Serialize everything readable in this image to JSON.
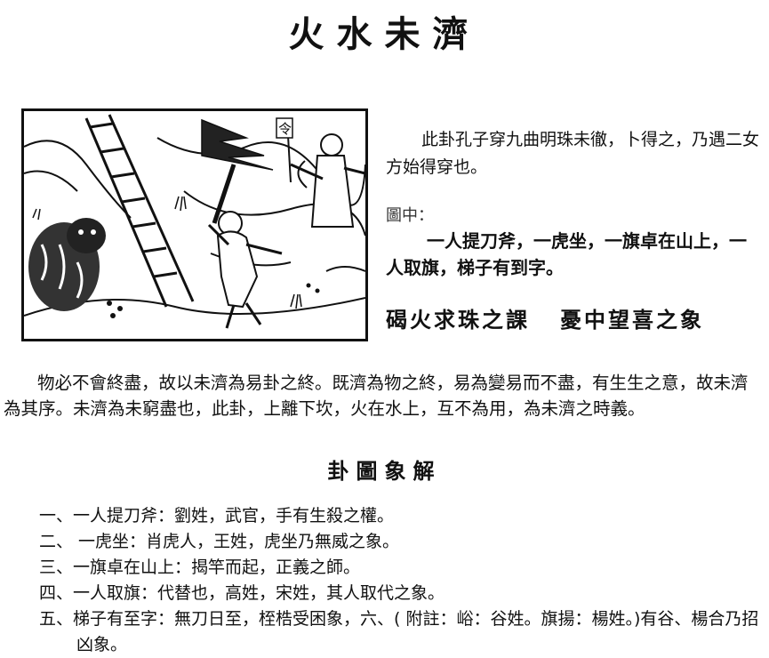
{
  "title": "火水未濟",
  "description": "此卦孔子穿九曲明珠未徹，卜得之，乃遇二女方始得穿也。",
  "figure_label": "圖中：",
  "figure_description": "一人提刀斧，一虎坐，一旗卓在山上，一人取旗，梯子有到字。",
  "lesson": {
    "name": "碣火求珠之課",
    "omen": "憂中望喜之象"
  },
  "paragraph": "物必不會終盡，故以未濟為易卦之終。既濟為物之終，易為變易而不盡，有生生之意，故未濟為其序。未濟為未窮盡也，此卦，上離下坎，火在水上，互不為用，為未濟之時義。",
  "subtitle": "卦圖象解",
  "items": [
    "一、一人提刀斧：劉姓，武官，手有生殺之權。",
    "二、 一虎坐：肖虎人，王姓，虎坐乃無威之象。",
    "三、一旗卓在山上：揭竿而起，正義之師。",
    "四、一人取旗：代替也，高姓，宋姓，其人取代之象。",
    "五、梯子有至字：無刀日至，桎梏受困象，六、( 附註：峪：谷姓。旗揚：楊姓。)有谷、楊合乃招凶象。"
  ],
  "woodcut_flag_char": "令"
}
